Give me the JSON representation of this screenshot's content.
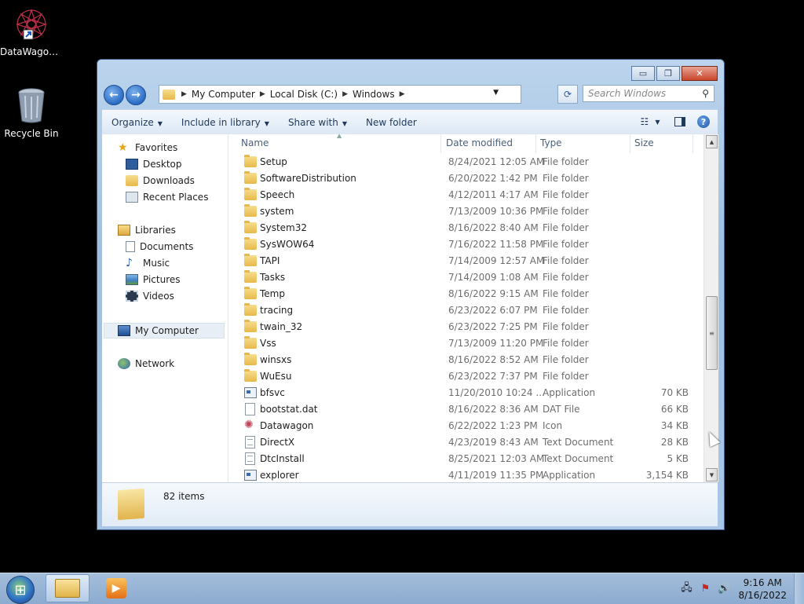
{
  "desktop": {
    "icons": [
      {
        "label": "DataWagon...",
        "icon": "datawagon-icon"
      },
      {
        "label": "Recycle Bin",
        "icon": "recycle-bin-icon"
      }
    ]
  },
  "window": {
    "address": {
      "crumbs": [
        "My Computer",
        "Local Disk (C:)",
        "Windows"
      ]
    },
    "search_placeholder": "Search Windows",
    "commands": {
      "organize": "Organize",
      "include": "Include in library",
      "share": "Share with",
      "new_folder": "New folder"
    },
    "nav": {
      "favorites": "Favorites",
      "desktop": "Desktop",
      "downloads": "Downloads",
      "recent": "Recent Places",
      "libraries": "Libraries",
      "documents": "Documents",
      "music": "Music",
      "pictures": "Pictures",
      "videos": "Videos",
      "computer": "My Computer",
      "network": "Network"
    },
    "columns": {
      "name": "Name",
      "date": "Date modified",
      "type": "Type",
      "size": "Size"
    },
    "files": [
      {
        "name": "Setup",
        "date": "8/24/2021 12:05 AM",
        "type": "File folder",
        "size": "",
        "icon": "folder"
      },
      {
        "name": "SoftwareDistribution",
        "date": "6/20/2022 1:42 PM",
        "type": "File folder",
        "size": "",
        "icon": "folder"
      },
      {
        "name": "Speech",
        "date": "4/12/2011 4:17 AM",
        "type": "File folder",
        "size": "",
        "icon": "folder"
      },
      {
        "name": "system",
        "date": "7/13/2009 10:36 PM",
        "type": "File folder",
        "size": "",
        "icon": "folder"
      },
      {
        "name": "System32",
        "date": "8/16/2022 8:40 AM",
        "type": "File folder",
        "size": "",
        "icon": "folder"
      },
      {
        "name": "SysWOW64",
        "date": "7/16/2022 11:58 PM",
        "type": "File folder",
        "size": "",
        "icon": "folder"
      },
      {
        "name": "TAPI",
        "date": "7/14/2009 12:57 AM",
        "type": "File folder",
        "size": "",
        "icon": "folder"
      },
      {
        "name": "Tasks",
        "date": "7/14/2009 1:08 AM",
        "type": "File folder",
        "size": "",
        "icon": "folder"
      },
      {
        "name": "Temp",
        "date": "8/16/2022 9:15 AM",
        "type": "File folder",
        "size": "",
        "icon": "folder"
      },
      {
        "name": "tracing",
        "date": "6/23/2022 6:07 PM",
        "type": "File folder",
        "size": "",
        "icon": "folder"
      },
      {
        "name": "twain_32",
        "date": "6/23/2022 7:25 PM",
        "type": "File folder",
        "size": "",
        "icon": "folder"
      },
      {
        "name": "Vss",
        "date": "7/13/2009 11:20 PM",
        "type": "File folder",
        "size": "",
        "icon": "folder"
      },
      {
        "name": "winsxs",
        "date": "8/16/2022 8:52 AM",
        "type": "File folder",
        "size": "",
        "icon": "folder"
      },
      {
        "name": "WuEsu",
        "date": "6/23/2022 7:37 PM",
        "type": "File folder",
        "size": "",
        "icon": "folder"
      },
      {
        "name": "bfsvc",
        "date": "11/20/2010 10:24 ...",
        "type": "Application",
        "size": "70 KB",
        "icon": "app"
      },
      {
        "name": "bootstat.dat",
        "date": "8/16/2022 8:36 AM",
        "type": "DAT File",
        "size": "66 KB",
        "icon": "doc"
      },
      {
        "name": "Datawagon",
        "date": "6/22/2022 1:23 PM",
        "type": "Icon",
        "size": "34 KB",
        "icon": "ico"
      },
      {
        "name": "DirectX",
        "date": "4/23/2019 8:43 AM",
        "type": "Text Document",
        "size": "28 KB",
        "icon": "txt"
      },
      {
        "name": "DtcInstall",
        "date": "8/25/2021 12:03 AM",
        "type": "Text Document",
        "size": "5 KB",
        "icon": "txt"
      },
      {
        "name": "explorer",
        "date": "4/11/2019 11:35 PM",
        "type": "Application",
        "size": "3,154 KB",
        "icon": "app"
      }
    ],
    "status": {
      "count": "82 items"
    }
  },
  "taskbar": {
    "time": "9:16 AM",
    "date": "8/16/2022"
  }
}
